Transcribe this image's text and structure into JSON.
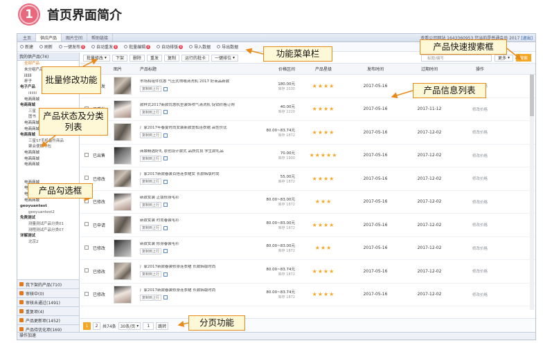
{
  "header": {
    "number": "1",
    "title": "首页界面简介"
  },
  "tabs": [
    "主页",
    "供应产品",
    "图片空间",
    "帮助链接"
  ],
  "account_info": "查看公司网站  1643360953  您当前是普通会员 2017",
  "exit_label": "[退出]",
  "toolbar": [
    {
      "label": "新建",
      "badge": ""
    },
    {
      "label": "刷新",
      "badge": ""
    },
    {
      "label": "一键发布",
      "badge": "0"
    },
    {
      "label": "自动重发",
      "badge": "0"
    },
    {
      "label": "批量编辑",
      "badge": "0"
    },
    {
      "label": "自动排版",
      "badge": "0"
    },
    {
      "label": "导入数据",
      "badge": ""
    },
    {
      "label": "导出数据",
      "badge": ""
    }
  ],
  "sidebar": {
    "head": "我的供产品(74)",
    "tree": [
      {
        "label": "全部产品",
        "level": 2,
        "sel": true
      },
      {
        "label": "未分组产品",
        "level": 2
      },
      {
        "label": "jjjjjjj",
        "level": 2
      },
      {
        "label": "杯子",
        "level": 2
      },
      {
        "label": "电子产品",
        "level": 1
      },
      {
        "label": "iiiiiiii",
        "level": 3
      },
      {
        "label": "电商商城",
        "level": 2
      },
      {
        "label": "电商商城",
        "level": 1
      },
      {
        "label": "三星",
        "level": 3
      },
      {
        "label": "图书",
        "level": 3
      },
      {
        "label": "电商商城",
        "level": 2
      },
      {
        "label": "电商商城",
        "level": 2
      },
      {
        "label": "电商商城",
        "level": 1
      },
      {
        "label": "三星S7手机备件商品",
        "level": 3
      },
      {
        "label": "聚会便携书包",
        "level": 3
      },
      {
        "label": "电商商城",
        "level": 2
      },
      {
        "label": "电商商城",
        "level": 2
      },
      {
        "label": "电商商城",
        "level": 2
      },
      {
        "label": "",
        "level": 2
      },
      {
        "label": "",
        "level": 2
      },
      {
        "label": "电商商城",
        "level": 2
      },
      {
        "label": "电商商城",
        "level": 2
      },
      {
        "label": "电商商城",
        "level": 2
      },
      {
        "label": "电商商城",
        "level": 2
      },
      {
        "label": "geoyuantest",
        "level": 1
      },
      {
        "label": "geoyuantest2",
        "level": 3
      },
      {
        "label": "免费测试",
        "level": 1
      },
      {
        "label": "测量测试产品分类01",
        "level": 3
      },
      {
        "label": "测程测试产品分类07",
        "level": 3
      },
      {
        "label": "详解测试",
        "level": 1
      },
      {
        "label": "北京2",
        "level": 3
      }
    ],
    "bottom": [
      "我下架的产品(710)",
      "审核中(0)",
      "审核未通过(1491)",
      "重复项(4)",
      "产品更新项(1452)",
      "产品待优化项(169)"
    ]
  },
  "actions": [
    "批量修改",
    "下架",
    "删除",
    "重发",
    "复制",
    "运行的批卡",
    "一键排位"
  ],
  "search_placeholder": "标题/编号",
  "more_label": "更多",
  "search_button": "搜索",
  "columns": [
    "状态",
    "图片",
    "产品标题",
    "价格区间",
    "产品星级",
    "发布时间",
    "过期时间",
    "操作"
  ],
  "rows": [
    {
      "status": "已重发",
      "title": "市场和组件优惠 气压式喷嘴清洗机 2017 好商品新款",
      "price": "180.00元",
      "stock": "库存 2030",
      "stars": "★★★★",
      "pub": "2017-05-16",
      "exp": "2017-11-12",
      "op": "修改价格"
    },
    {
      "status": "已重发",
      "title": "款样式2017新款优惠机型装饰喷气清洗机 促销价格订购",
      "price": "40.00元",
      "stock": "库存 2220",
      "stars": "★★★★",
      "pub": "2017-05-16",
      "exp": "2017-11-12",
      "op": "修改价格"
    },
    {
      "status": "已申请",
      "title": "厂家2017年春夏时尚女装新款宽松连衣裙 高性价比",
      "price": "80.00~83.74元",
      "stock": "库存 1872",
      "stars": "★★★★",
      "pub": "2017-05-16",
      "exp": "2017-12-02",
      "op": "修改价格"
    },
    {
      "status": "已出售",
      "title": "商城精选好礼 原创设计款式 品质优良 学生款礼品",
      "price": "70.00元",
      "stock": "库存 1900",
      "stars": "★★★★★",
      "pub": "2017-05-16",
      "exp": "2017-12-02",
      "op": "修改价格"
    },
    {
      "status": "已修改",
      "title": "厂家2017新款春装百搭连衣裙女 长款韩版时尚",
      "price": "55.00元",
      "stock": "库存 1872",
      "stars": "★★★★",
      "pub": "2017-05-16",
      "exp": "2017-12-02",
      "op": "修改价格"
    },
    {
      "status": "已修改",
      "title": "新款女装 正版修身毛衫",
      "price": "80.00~83.00元",
      "stock": "库存 1872",
      "stars": "★★★",
      "pub": "2017-05-16",
      "exp": "2017-12-02",
      "op": "修改价格"
    },
    {
      "status": "已申请",
      "title": "新款女装 时尚春装毛衫",
      "price": "80.00~83.00元",
      "stock": "库存 1872",
      "stars": "★★★★",
      "pub": "2017-05-16",
      "exp": "2017-12-02",
      "op": "修改价格"
    },
    {
      "status": "已修改",
      "title": "新款女装 修身春装毛衫",
      "price": "80.00~83.00元",
      "stock": "库存 1872",
      "stars": "★★★",
      "pub": "2017-05-16",
      "exp": "2017-12-02",
      "op": "修改价格"
    },
    {
      "status": "已修改",
      "title": "厂家2017新款春装修身连衣裙 长款韩版时尚",
      "price": "80.00~83.74元",
      "stock": "库存 1872",
      "stars": "★★★★",
      "pub": "2017-05-16",
      "exp": "2017-12-02",
      "op": "修改价格"
    },
    {
      "status": "已修改",
      "title": "厂家2017新款春装修身连衣裙 长款韩版时尚",
      "price": "80.00~83.74元",
      "stock": "库存 1872",
      "stars": "★★★★",
      "pub": "2017-05-16",
      "exp": "2017-12-02",
      "op": "修改价格"
    }
  ],
  "row_button": "复制到上行",
  "pager": {
    "current": "1",
    "next": "2",
    "total": "共74条",
    "per_page": "30条/页",
    "jump_value": "1",
    "jump_label": "跳转"
  },
  "statusbar": "操作加速",
  "callouts": {
    "menu": "功能菜单栏",
    "search": "产品快速搜索框",
    "batch": "批量修改功能",
    "list": "产品信息列表",
    "category": "产品状态及分类列表",
    "checkbox": "产品勾选框",
    "pager": "分页功能"
  },
  "colors": {
    "accent": "#f5a623",
    "callout_border": "#e88a1a",
    "callout_bg": "#fff8d6",
    "badge": "#e8697e"
  }
}
